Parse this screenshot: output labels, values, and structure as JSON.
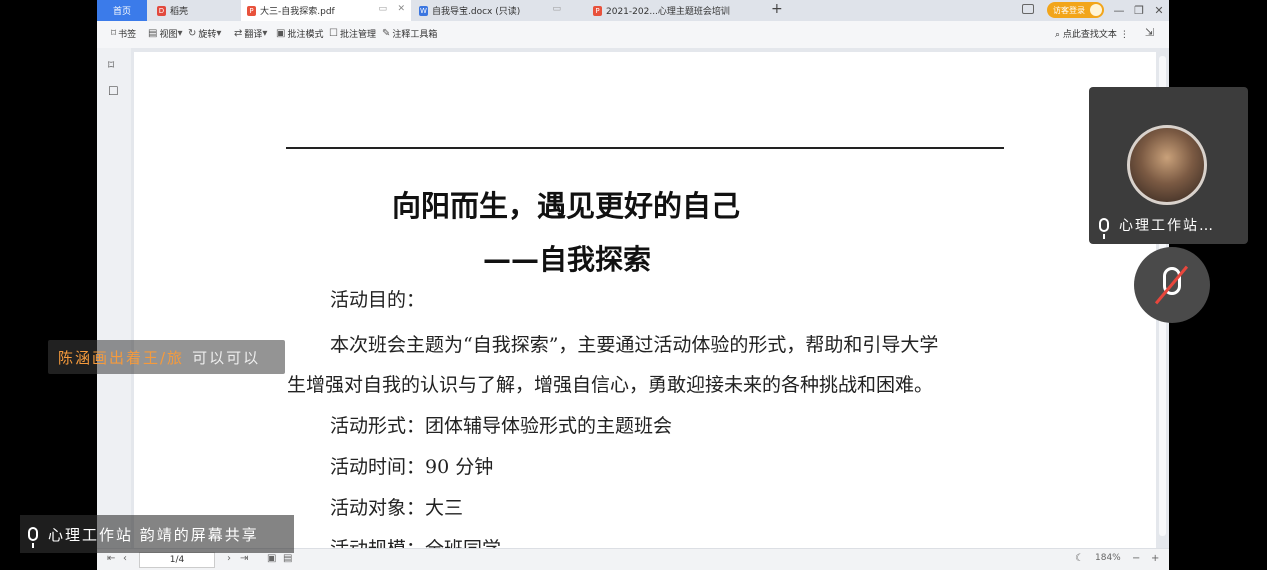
{
  "tabs": [
    {
      "label": "首页"
    },
    {
      "label": "稻壳"
    },
    {
      "label": "大三-自我探索.pdf"
    },
    {
      "label": "自我导宝.docx (只读)"
    },
    {
      "label": "2021-202...心理主题班会培训"
    }
  ],
  "tabbar": {
    "new_tab": "+",
    "login_label": "访客登录",
    "win_min": "—",
    "win_restore": "❐",
    "win_close": "✕"
  },
  "toolbar": {
    "bookmark": "书签",
    "view": "视图",
    "rotate": "旋转",
    "translate": "翻译",
    "annotation_mode": "批注模式",
    "annotation_manage": "批注管理",
    "annotation_tools": "注释工具箱",
    "search_text": "点此查找文本"
  },
  "document": {
    "title": "向阳而生，遇见更好的自己",
    "subtitle": "——自我探索",
    "lines": [
      "活动目的：",
      "本次班会主题为“自我探索”，主要通过活动体验的形式，帮助和引导大学",
      "生增强对自我的认识与了解，增强自信心，勇敢迎接未来的各种挑战和困难。",
      "活动形式：团体辅导体验形式的主题班会",
      "活动时间：90 分钟",
      "活动对象：大三",
      "活动规模：全班同学"
    ]
  },
  "statusbar": {
    "page_indicator": "1/4",
    "zoom": "184%"
  },
  "overlay": {
    "chat_name": "陈涵画出着王/旅",
    "chat_message": "可以可以",
    "share_text": "心理工作站 韵靖的屏幕共享",
    "speaker_name": "心理工作站…"
  },
  "colors": {
    "home_tab": "#3b7bea",
    "login_button": "#f2a51a",
    "mute_slash": "#e8463c"
  }
}
